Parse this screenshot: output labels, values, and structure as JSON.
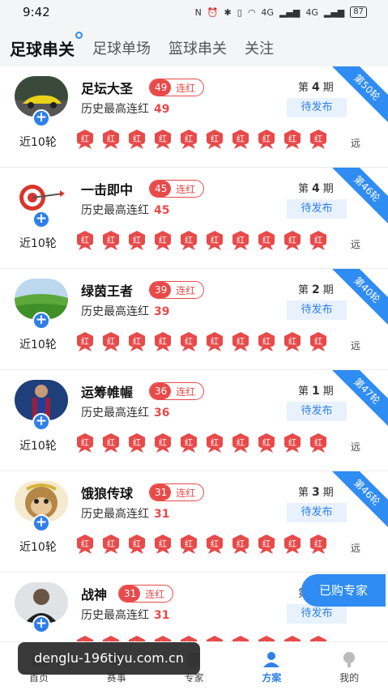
{
  "status_bar": {
    "time": "9:42",
    "signal1": "4G",
    "signal2": "4G",
    "battery": "87"
  },
  "tabs": [
    {
      "label": "足球串关",
      "active": true
    },
    {
      "label": "足球单场",
      "active": false
    },
    {
      "label": "篮球串关",
      "active": false
    },
    {
      "label": "关注",
      "active": false
    }
  ],
  "common": {
    "streak_suffix": "连红",
    "history_prefix": "历史最高连红",
    "period_prefix": "第",
    "period_suffix": "期",
    "recent_label": "近10轮",
    "hong_label": "红",
    "far_label": "远",
    "plus": "+"
  },
  "cards": [
    {
      "name": "足坛大圣",
      "streak": "49",
      "history": "49",
      "period": "4",
      "status": "待发布",
      "ribbon": "第50轮",
      "avatar": "car-icon"
    },
    {
      "name": "一击即中",
      "streak": "45",
      "history": "45",
      "period": "4",
      "status": "待发布",
      "ribbon": "第46轮",
      "avatar": "target-icon"
    },
    {
      "name": "绿茵王者",
      "streak": "39",
      "history": "39",
      "period": "2",
      "status": "待发布",
      "ribbon": "第40轮",
      "avatar": "field-icon"
    },
    {
      "name": "运筹帷幄",
      "streak": "36",
      "history": "36",
      "period": "1",
      "status": "待发布",
      "ribbon": "第47轮",
      "avatar": "player-icon"
    },
    {
      "name": "饿狼传球",
      "streak": "31",
      "history": "31",
      "period": "3",
      "status": "待发布",
      "ribbon": "第46轮",
      "avatar": "monkey-icon"
    },
    {
      "name": "战神",
      "streak": "31",
      "history": "31",
      "period": "",
      "status": "待发布",
      "ribbon": "",
      "avatar": "man-icon"
    }
  ],
  "float_button": "已购专家",
  "watermark": "denglu-196tiyu.com.cn",
  "bottom_nav": [
    {
      "label": "首页",
      "icon": "home-icon",
      "active": false
    },
    {
      "label": "赛事",
      "icon": "match-icon",
      "active": false
    },
    {
      "label": "专家",
      "icon": "expert-icon",
      "active": false
    },
    {
      "label": "方案",
      "icon": "plan-icon",
      "active": true
    },
    {
      "label": "我的",
      "icon": "profile-icon",
      "active": false
    }
  ],
  "colors": {
    "accent": "#2f8cf2",
    "red": "#e84a4a"
  }
}
